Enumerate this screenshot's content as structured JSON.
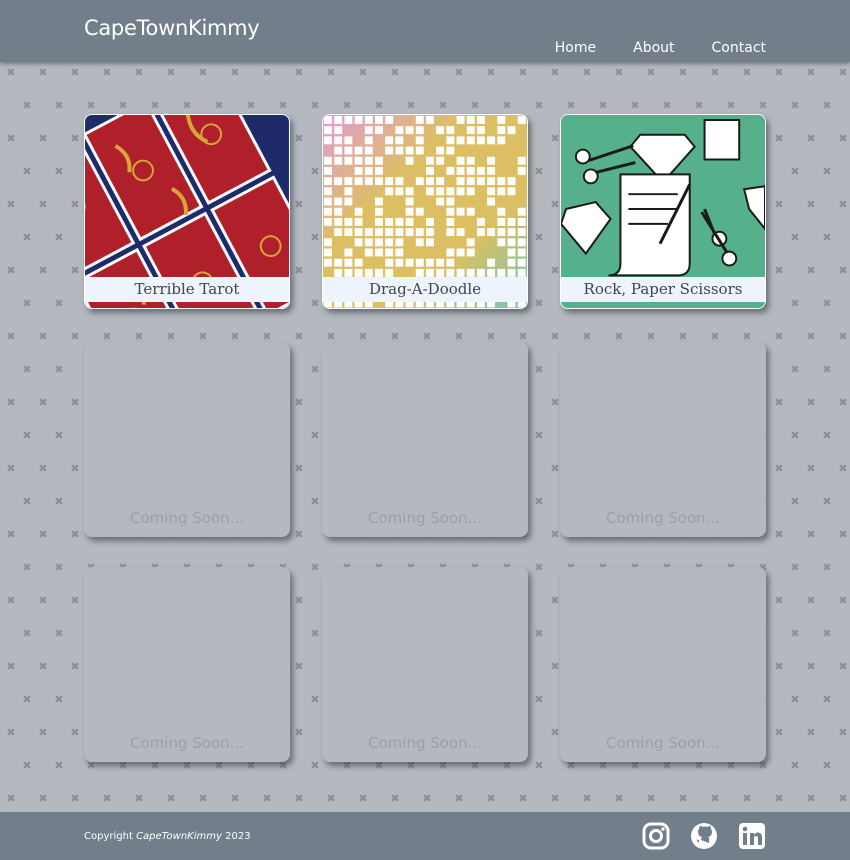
{
  "header": {
    "brand": "CapeTownKimmy",
    "nav": [
      "Home",
      "About",
      "Contact"
    ]
  },
  "projects": [
    {
      "title": "Terrible Tarot",
      "thumb": "tarot-pattern"
    },
    {
      "title": "Drag-A-Doodle",
      "thumb": "pixel-grid-pattern"
    },
    {
      "title": "Rock, Paper Scissors",
      "thumb": "rock-paper-scissors-pattern"
    }
  ],
  "placeholders": [
    "Coming Soon...",
    "Coming Soon...",
    "Coming Soon...",
    "Coming Soon...",
    "Coming Soon...",
    "Coming Soon..."
  ],
  "footer": {
    "copyright_prefix": "Copyright",
    "copyright_name": "CapeTownKimmy",
    "copyright_year": "2023",
    "socials": [
      "instagram-icon",
      "github-icon",
      "linkedin-icon"
    ]
  },
  "colors": {
    "header_bg": "#727e8a",
    "page_bg": "#b4b9bf",
    "caption_bg": "#eef4fb",
    "caption_text": "#3b4652",
    "soon_text": "#98a1ab"
  }
}
